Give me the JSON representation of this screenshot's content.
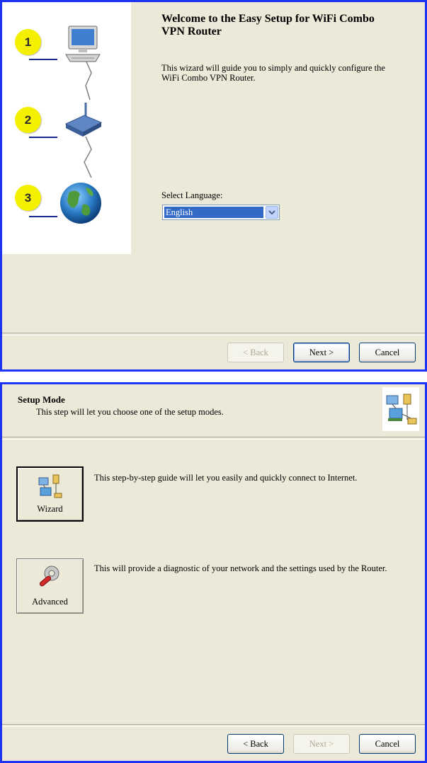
{
  "welcome": {
    "title": "Welcome to the Easy Setup for WiFi Combo VPN Router",
    "description": "This wizard will guide you to simply and quickly configure the WiFi Combo VPN Router.",
    "steps": [
      "1",
      "2",
      "3"
    ],
    "language_label": "Select Language:",
    "language_value": "English",
    "buttons": {
      "back": "< Back",
      "next": "Next >",
      "cancel": "Cancel"
    }
  },
  "setup_mode": {
    "title": "Setup Mode",
    "subtitle": "This step will let you choose one of the setup modes.",
    "wizard": {
      "label": "Wizard",
      "description": "This step-by-step guide will let you easily and quickly connect to Internet."
    },
    "advanced": {
      "label": "Advanced",
      "description": "This will provide a diagnostic of your network and the settings used by the Router."
    },
    "buttons": {
      "back": "< Back",
      "next": "Next >",
      "cancel": "Cancel"
    }
  },
  "colors": {
    "frame_border": "#1d34f4",
    "dialog_bg": "#ece9d8",
    "step_badge": "#f4f000",
    "selection": "#316ac5"
  },
  "icons": [
    "computer-icon",
    "router-icon",
    "globe-icon",
    "network-icon",
    "wrench-icon",
    "dropdown-arrow-icon"
  ]
}
